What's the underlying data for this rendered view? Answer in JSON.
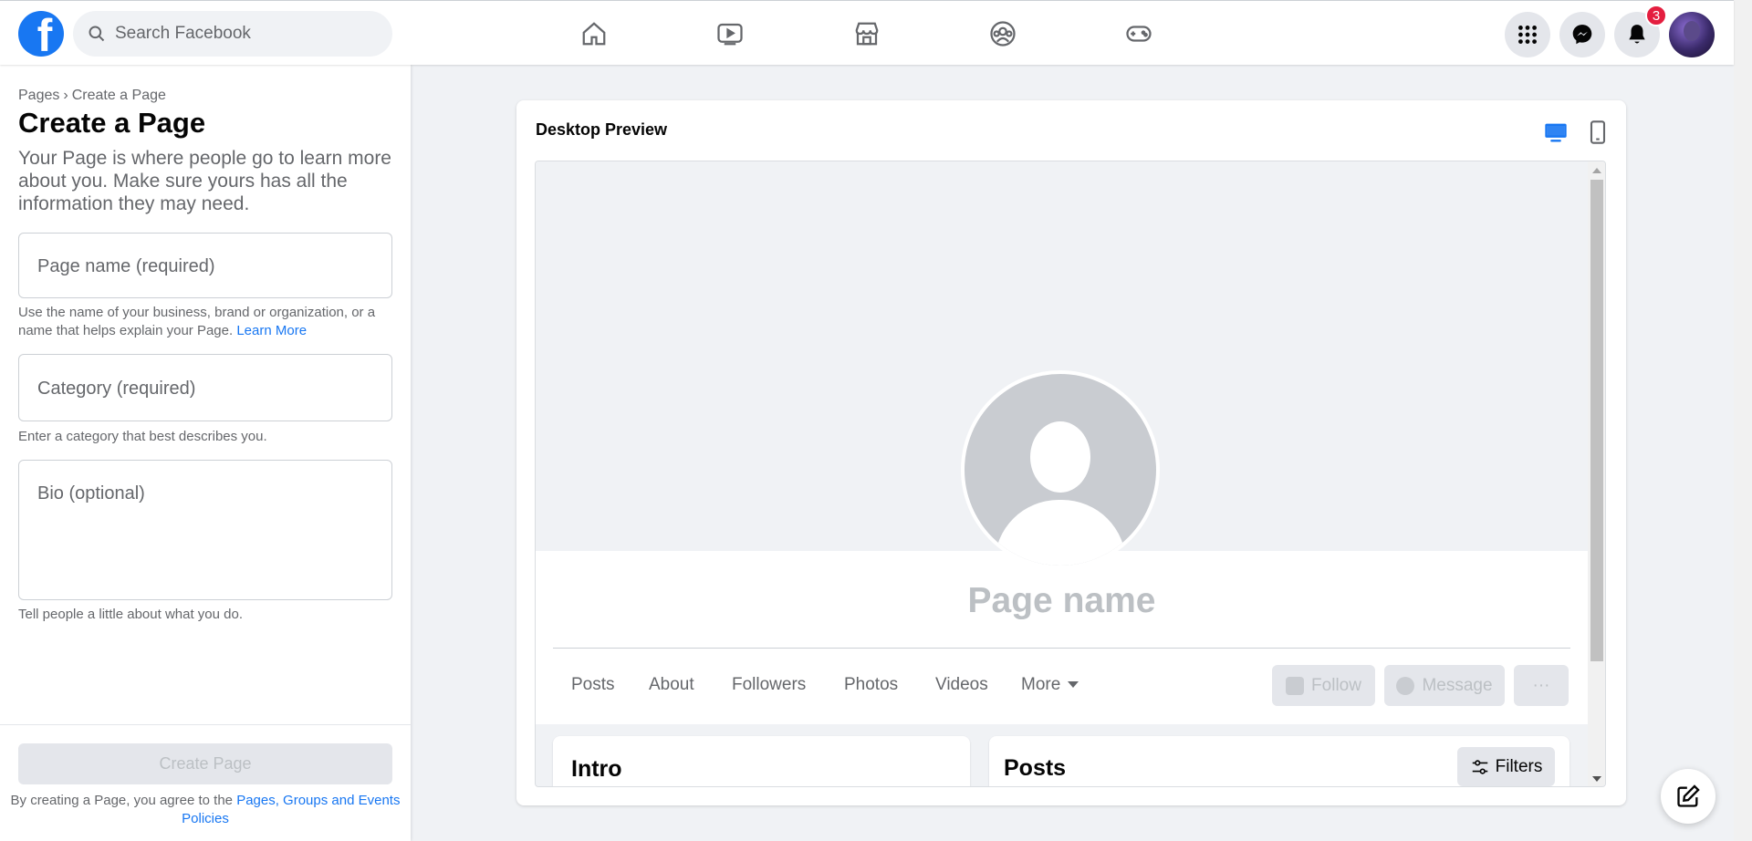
{
  "topbar": {
    "logo_letter": "f",
    "search_placeholder": "Search Facebook",
    "nav_icons": [
      "home-icon",
      "watch-icon",
      "marketplace-icon",
      "groups-icon",
      "gaming-icon"
    ],
    "notification_count": "3",
    "brand_color": "#1877f2"
  },
  "left_panel": {
    "breadcrumb": [
      "Pages",
      "Create a Page"
    ],
    "breadcrumb_sep": "›",
    "title": "Create a Page",
    "subtitle": "Your Page is where people go to learn more about you. Make sure yours has all the information they may need.",
    "page_name_placeholder": "Page name (required)",
    "page_name_hint": "Use the name of your business, brand or organization, or a name that helps explain your Page.",
    "learn_more": "Learn More",
    "category_placeholder": "Category (required)",
    "category_hint": "Enter a category that best describes you.",
    "bio_placeholder": "Bio (optional)",
    "bio_hint": "Tell people a little about what you do.",
    "create_button": "Create Page",
    "terms_text": "By creating a Page, you agree to the",
    "terms_link": "Pages, Groups and Events Policies"
  },
  "preview": {
    "title": "Desktop Preview",
    "page_name": "Page name",
    "tabs": [
      "Posts",
      "About",
      "Followers",
      "Photos",
      "Videos",
      "More"
    ],
    "follow_button": "Follow",
    "message_button": "Message",
    "more_button": "···",
    "intro_title": "Intro",
    "posts_title": "Posts",
    "filters_button": "Filters"
  }
}
